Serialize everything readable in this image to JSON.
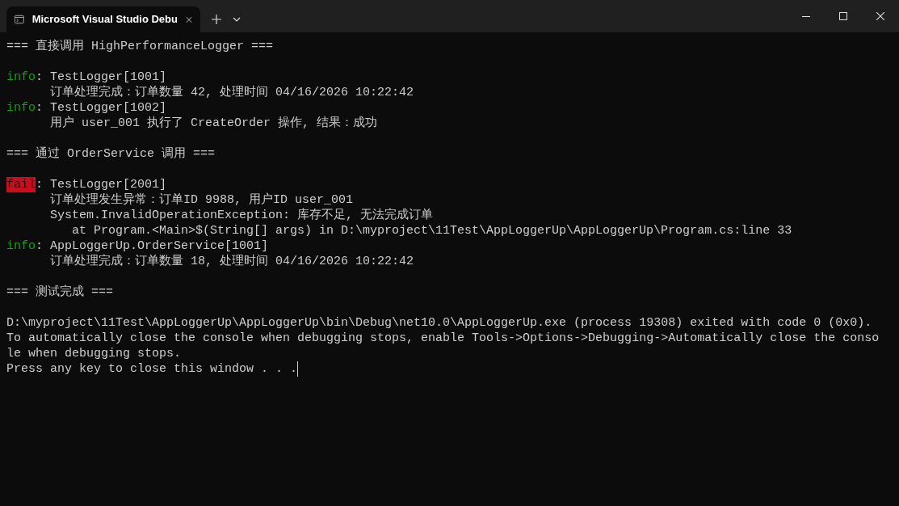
{
  "window": {
    "tab": {
      "title": "Microsoft Visual Studio Debu",
      "selected": true
    }
  },
  "console": {
    "lines": [
      {
        "kind": "plain",
        "text": "=== 直接调用 HighPerformanceLogger ==="
      },
      {
        "kind": "blank"
      },
      {
        "kind": "log",
        "severity": "info",
        "text": ": TestLogger[1001]"
      },
      {
        "kind": "detail",
        "text": "订单处理完成：订单数量 42, 处理时间 04/16/2026 10:22:42"
      },
      {
        "kind": "log",
        "severity": "info",
        "text": ": TestLogger[1002]"
      },
      {
        "kind": "detail",
        "text": "用户 user_001 执行了 CreateOrder 操作, 结果：成功"
      },
      {
        "kind": "blank"
      },
      {
        "kind": "plain",
        "text": "=== 通过 OrderService 调用 ==="
      },
      {
        "kind": "blank"
      },
      {
        "kind": "log",
        "severity": "fail",
        "text": ": TestLogger[2001]"
      },
      {
        "kind": "detail",
        "text": "订单处理发生异常：订单ID 9988, 用户ID user_001"
      },
      {
        "kind": "detail",
        "text": "System.InvalidOperationException: 库存不足, 无法完成订单"
      },
      {
        "kind": "stack",
        "text": "at Program.<Main>$(String[] args) in D:\\myproject\\11Test\\AppLoggerUp\\AppLoggerUp\\Program.cs:line 33"
      },
      {
        "kind": "log",
        "severity": "info",
        "text": ": AppLoggerUp.OrderService[1001]"
      },
      {
        "kind": "detail",
        "text": "订单处理完成：订单数量 18, 处理时间 04/16/2026 10:22:42"
      },
      {
        "kind": "blank"
      },
      {
        "kind": "plain",
        "text": "=== 测试完成 ==="
      },
      {
        "kind": "blank"
      },
      {
        "kind": "plain",
        "text": "D:\\myproject\\11Test\\AppLoggerUp\\AppLoggerUp\\bin\\Debug\\net10.0\\AppLoggerUp.exe (process 19308) exited with code 0 (0x0)."
      },
      {
        "kind": "plain",
        "text": "To automatically close the console when debugging stops, enable Tools->Options->Debugging->Automatically close the conso"
      },
      {
        "kind": "plain",
        "text": "le when debugging stops."
      },
      {
        "kind": "prompt",
        "text": "Press any key to close this window . . ."
      }
    ]
  }
}
